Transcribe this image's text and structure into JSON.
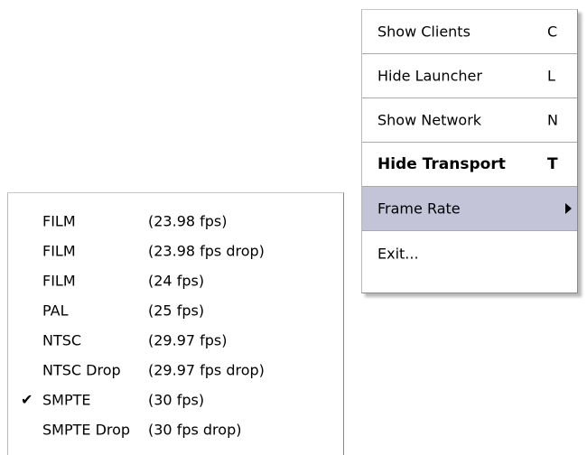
{
  "context_menu": {
    "items": [
      {
        "label": "Show Clients",
        "shortcut": "C"
      },
      {
        "label": "Hide Launcher",
        "shortcut": "L"
      },
      {
        "label": "Show Network",
        "shortcut": "N"
      },
      {
        "label": "Hide Transport",
        "shortcut": "T",
        "bold": true
      },
      {
        "label": "Frame Rate",
        "shortcut": "",
        "has_submenu": true,
        "highlighted": true
      },
      {
        "label": "Exit...",
        "shortcut": ""
      }
    ],
    "highlight_color": "#c4c4d9"
  },
  "frame_rate_submenu": {
    "items": [
      {
        "name": "FILM",
        "rate": "(23.98 fps)",
        "checked": false
      },
      {
        "name": "FILM",
        "rate": "(23.98 fps drop)",
        "checked": false
      },
      {
        "name": "FILM",
        "rate": "(24 fps)",
        "checked": false
      },
      {
        "name": "PAL",
        "rate": "(25 fps)",
        "checked": false
      },
      {
        "name": "NTSC",
        "rate": "(29.97 fps)",
        "checked": false
      },
      {
        "name": "NTSC Drop",
        "rate": "(29.97 fps drop)",
        "checked": false
      },
      {
        "name": "SMPTE",
        "rate": "(30 fps)",
        "checked": true,
        "check_mark": "✔"
      },
      {
        "name": "SMPTE Drop",
        "rate": "(30 fps drop)",
        "checked": false
      }
    ]
  },
  "icons": {
    "submenu_arrow": "chevron-right-icon",
    "check": "checkmark-icon"
  }
}
